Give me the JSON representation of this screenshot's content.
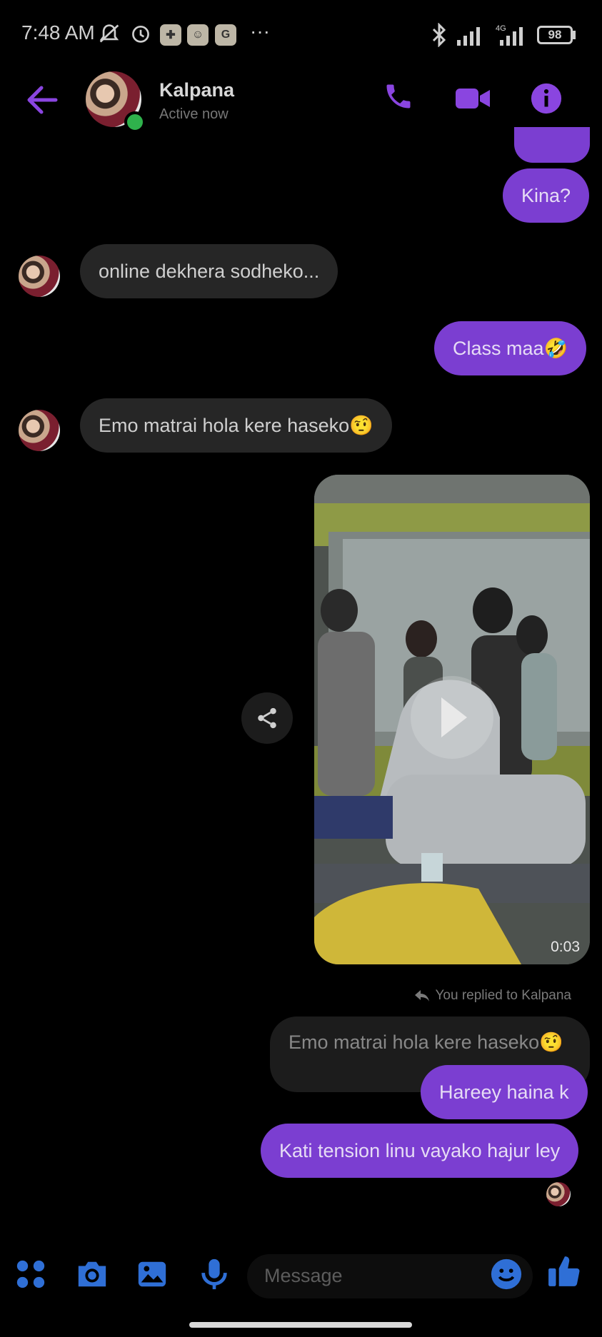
{
  "status_bar": {
    "time": "7:48 AM",
    "network": "4G",
    "battery": "98"
  },
  "header": {
    "contact_name": "Kalpana",
    "contact_status": "Active now"
  },
  "messages": [
    {
      "side": "out",
      "text": "Kina?"
    },
    {
      "side": "in",
      "text": "online dekhera sodheko..."
    },
    {
      "side": "out",
      "text": "Class maa🤣"
    },
    {
      "side": "in",
      "text": "Emo matrai hola kere haseko🤨"
    },
    {
      "side": "out",
      "type": "video",
      "duration": "0:03"
    },
    {
      "side": "out",
      "reply_note": "You replied to Kalpana",
      "quoted": "Emo matrai hola kere haseko🤨",
      "text": "Hareey haina k"
    },
    {
      "side": "out",
      "text": "Kati tension linu vayako hajur ley"
    }
  ],
  "composer": {
    "placeholder": "Message"
  },
  "colors": {
    "accent": "#7b3ed1",
    "icon_purple": "#8a45e0",
    "icon_blue": "#2f6fd6",
    "incoming_bubble": "#262626"
  }
}
